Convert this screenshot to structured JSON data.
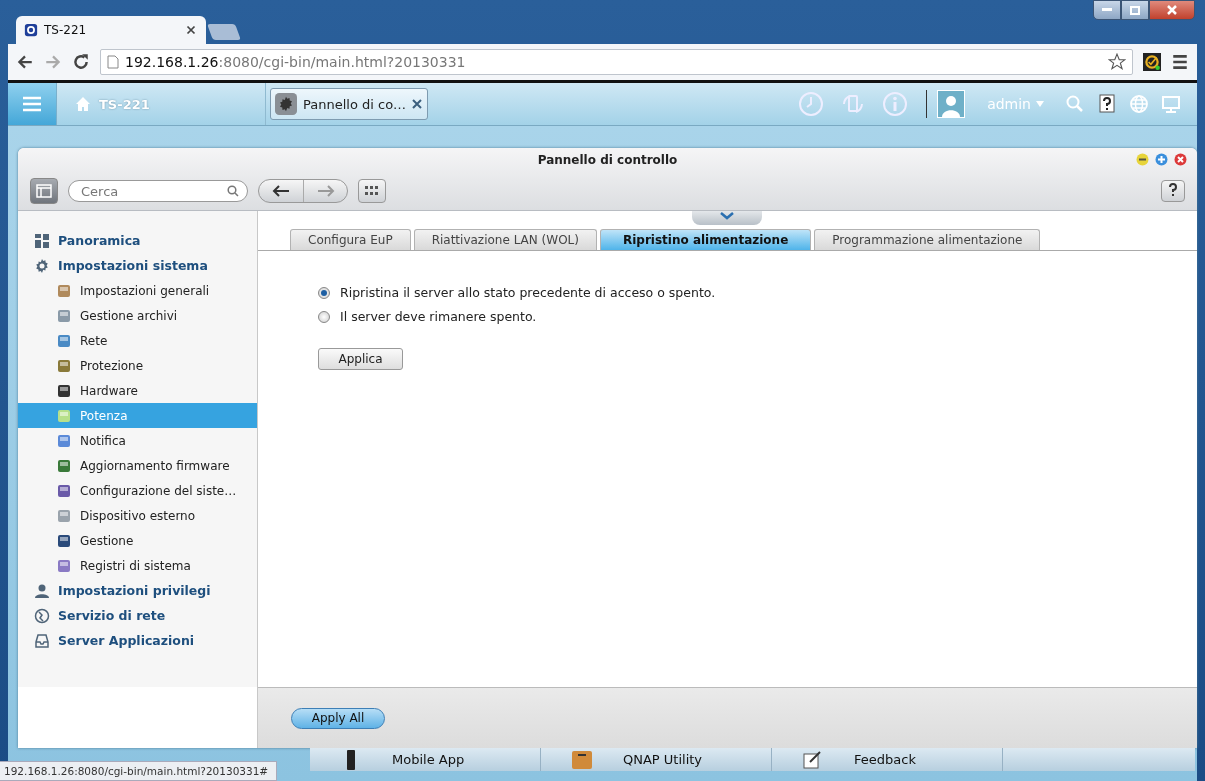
{
  "browser": {
    "tab": {
      "title": "TS-221"
    },
    "url": {
      "host": "192.168.1.26",
      "rest": ":8080/cgi-bin/main.html?20130331"
    }
  },
  "qts_bar": {
    "home_label": "TS-221",
    "app_tab": "Pannello di co…",
    "user": "admin"
  },
  "window": {
    "title": "Pannello di controllo",
    "search": {
      "placeholder": "Cerca"
    }
  },
  "sidebar": {
    "items": [
      {
        "label": "Panoramica",
        "selected": false
      },
      {
        "label": "Impostazioni sistema",
        "selected": false,
        "children": [
          {
            "label": "Impostazioni generali",
            "selected": false
          },
          {
            "label": "Gestione archivi",
            "selected": false
          },
          {
            "label": "Rete",
            "selected": false
          },
          {
            "label": "Protezione",
            "selected": false
          },
          {
            "label": "Hardware",
            "selected": false
          },
          {
            "label": "Potenza",
            "selected": true
          },
          {
            "label": "Notifica",
            "selected": false
          },
          {
            "label": "Aggiornamento firmware",
            "selected": false
          },
          {
            "label": "Configurazione del siste…",
            "selected": false
          },
          {
            "label": "Dispositivo esterno",
            "selected": false
          },
          {
            "label": "Gestione",
            "selected": false
          },
          {
            "label": "Registri di sistema",
            "selected": false
          }
        ]
      },
      {
        "label": "Impostazioni privilegi",
        "selected": false
      },
      {
        "label": "Servizio di rete",
        "selected": false
      },
      {
        "label": "Server Applicazioni",
        "selected": false
      }
    ]
  },
  "tabs": [
    {
      "label": "Configura EuP",
      "selected": false
    },
    {
      "label": "Riattivazione LAN (WOL)",
      "selected": false
    },
    {
      "label": "Ripristino alimentazione",
      "selected": true
    },
    {
      "label": "Programmazione alimentazione",
      "selected": false
    }
  ],
  "options": [
    {
      "label": "Ripristina il server allo stato precedente di acceso o spento.",
      "selected": true
    },
    {
      "label": "Il server deve rimanere spento.",
      "selected": false
    }
  ],
  "apply_button": "Applica",
  "footer_button": "Apply All",
  "dock": [
    {
      "label": "Mobile App"
    },
    {
      "label": "QNAP Utility"
    },
    {
      "label": "Feedback"
    }
  ],
  "status_bar": "192.168.1.26:8080/cgi-bin/main.html?20130331#"
}
